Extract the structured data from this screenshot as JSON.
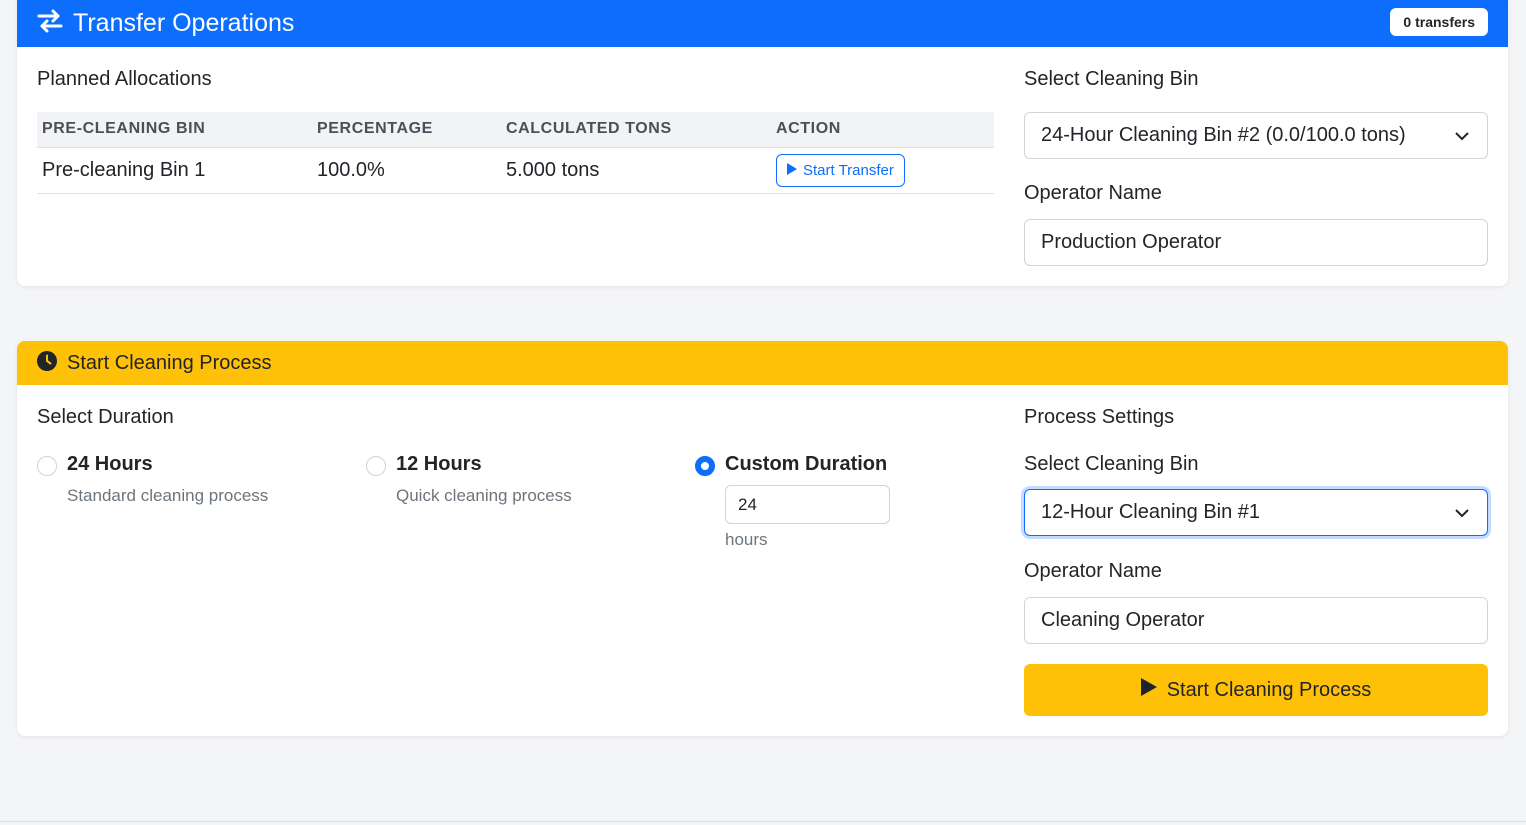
{
  "transfer": {
    "title": "Transfer Operations",
    "badge": "0 transfers",
    "section_title": "Planned Allocations",
    "table": {
      "headers": [
        "PRE-CLEANING BIN",
        "PERCENTAGE",
        "CALCULATED TONS",
        "ACTION"
      ],
      "rows": [
        {
          "bin": "Pre-cleaning Bin 1",
          "percentage": "100.0%",
          "tons": "5.000 tons",
          "action": "Start Transfer"
        }
      ]
    },
    "bin_label": "Select Cleaning Bin",
    "bin_value": "24-Hour Cleaning Bin #2 (0.0/100.0 tons)",
    "operator_label": "Operator Name",
    "operator_value": "Production Operator"
  },
  "cleaning": {
    "title": "Start Cleaning Process",
    "duration_title": "Select Duration",
    "options": [
      {
        "title": "24 Hours",
        "desc": "Standard cleaning process",
        "checked": false
      },
      {
        "title": "12 Hours",
        "desc": "Quick cleaning process",
        "checked": false
      },
      {
        "title": "Custom Duration",
        "checked": true
      }
    ],
    "custom_hours": "24",
    "hours_unit": "hours",
    "settings_title": "Process Settings",
    "bin_label": "Select Cleaning Bin",
    "bin_value": "12-Hour Cleaning Bin #1",
    "operator_label": "Operator Name",
    "operator_value": "Cleaning Operator",
    "start_button": "Start Cleaning Process"
  },
  "colors": {
    "primary": "#0d6efd",
    "warning": "#ffc107"
  },
  "icons": {
    "transfer": "exchange-arrows-icon",
    "clock": "clock-icon",
    "play": "play-icon",
    "chevron": "chevron-down-icon"
  }
}
